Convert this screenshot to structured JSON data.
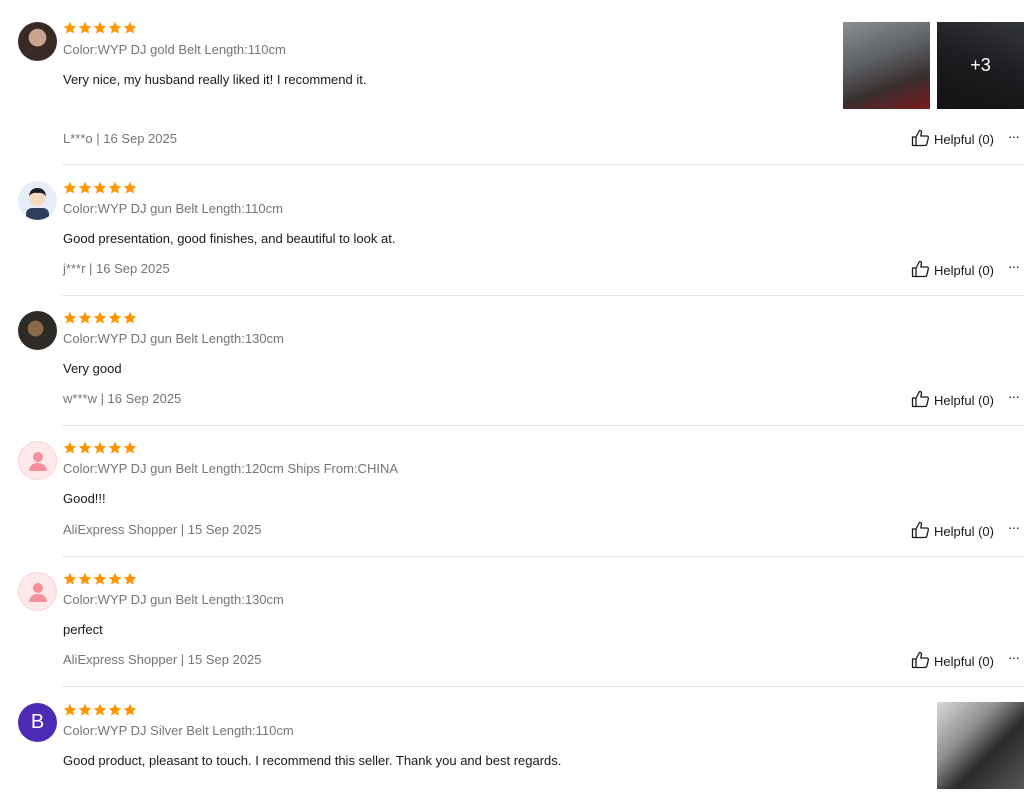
{
  "reviews": [
    {
      "rating": 5,
      "avatar": "photo",
      "variant": "Color:WYP DJ gold Belt Length:110cm",
      "text": "Very nice, my husband really liked it! I recommend it.",
      "meta": "L***o | 16 Sep 2025",
      "helpful": "Helpful (0)",
      "extra_images": "+3"
    },
    {
      "rating": 5,
      "avatar": "cartoon",
      "variant": "Color:WYP DJ gun Belt Length:110cm",
      "text": "Good presentation, good finishes, and beautiful to look at.",
      "meta": "j***r | 16 Sep 2025",
      "helpful": "Helpful (0)"
    },
    {
      "rating": 5,
      "avatar": "photo",
      "variant": "Color:WYP DJ gun Belt Length:130cm",
      "text": "Very good",
      "meta": "w***w | 16 Sep 2025",
      "helpful": "Helpful (0)"
    },
    {
      "rating": 5,
      "avatar": "default-user-icon",
      "variant": "Color:WYP DJ gun Belt Length:120cm Ships From:CHINA",
      "text": "Good!!!",
      "meta": "AliExpress Shopper | 15 Sep 2025",
      "helpful": "Helpful (0)"
    },
    {
      "rating": 5,
      "avatar": "default-user-icon",
      "variant": "Color:WYP DJ gun Belt Length:130cm",
      "text": "perfect",
      "meta": "AliExpress Shopper | 15 Sep 2025",
      "helpful": "Helpful (0)"
    },
    {
      "rating": 5,
      "avatar": "letter",
      "avatar_letter": "B",
      "variant": "Color:WYP DJ Silver Belt Length:110cm",
      "text": "Good product, pleasant to touch. I recommend this seller. Thank you and best regards."
    }
  ],
  "more_icon": "ellipsis-icon",
  "helpful_icon": "thumbs-up-icon",
  "colors": {
    "star": "#ff9500",
    "meta": "#757575",
    "text": "#191919",
    "avatar_letter_bg": "#4e2bb5"
  }
}
